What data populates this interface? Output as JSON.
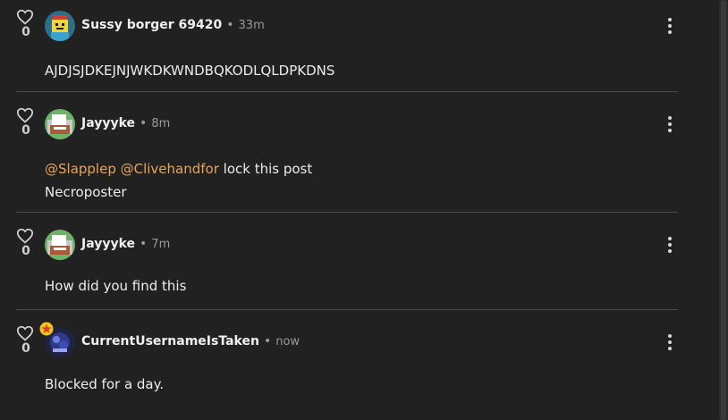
{
  "posts": [
    {
      "likes": "0",
      "username": "Sussy borger 69420",
      "dot": "•",
      "time": "33m",
      "lines": [
        "AJDJSJDKEJNJWKDKWNDBQKODLQLDPKDNS"
      ]
    },
    {
      "likes": "0",
      "username": "Jayyyke",
      "dot": "•",
      "time": "8m",
      "mentions": [
        "@Slapplep",
        "@Clivehandfor"
      ],
      "line1_rest": " lock this post",
      "line2": "Necroposter"
    },
    {
      "likes": "0",
      "username": "Jayyyke",
      "dot": "•",
      "time": "7m",
      "lines": [
        "How did you find this"
      ]
    },
    {
      "likes": "0",
      "username": "CurrentUsernameIsTaken",
      "dot": "•",
      "time": "now",
      "lines": [
        "Blocked for a day."
      ]
    }
  ],
  "colors": {
    "background": "#212121",
    "mention": "#e6a45c",
    "divider": "#4a4a4a",
    "badge": "#f5c518"
  }
}
